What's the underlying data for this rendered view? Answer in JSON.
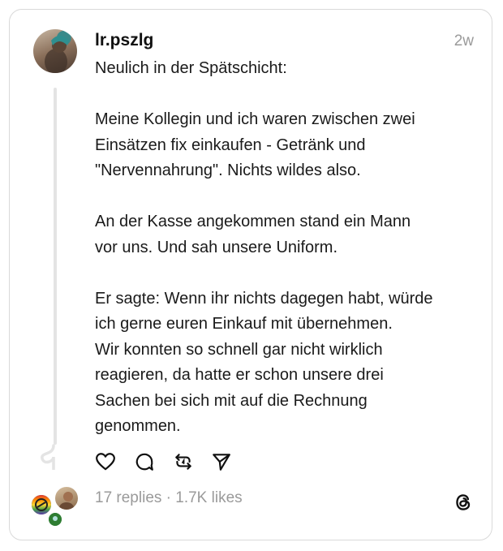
{
  "post": {
    "username": "lr.pszlg",
    "timestamp": "2w",
    "paragraphs": [
      [
        "Neulich in der Spätschicht:"
      ],
      [
        "Meine Kollegin und ich waren zwischen zwei",
        "Einsätzen fix einkaufen - Getränk und",
        "\"Nervennahrung\". Nichts wildes also."
      ],
      [
        "An der Kasse angekommen stand ein Mann",
        "vor uns. Und sah unsere Uniform."
      ],
      [
        "Er sagte: Wenn ihr nichts dagegen habt, würde",
        "ich gerne euren Einkauf mit übernehmen.",
        "Wir konnten so schnell gar nicht wirklich",
        "reagieren, da hatte er schon unsere drei",
        "Sachen bei sich mit auf die Rechnung",
        "genommen."
      ]
    ],
    "stats": "17 replies · 1.7K likes"
  },
  "icons": {
    "like": "heart-icon",
    "reply": "comment-icon",
    "repost": "repost-icon",
    "share": "send-icon",
    "brand": "threads-logo-icon"
  },
  "colors": {
    "text": "#101010",
    "muted": "#9a9a9a",
    "border": "#d9d9d9",
    "line": "#e4e4e4"
  }
}
